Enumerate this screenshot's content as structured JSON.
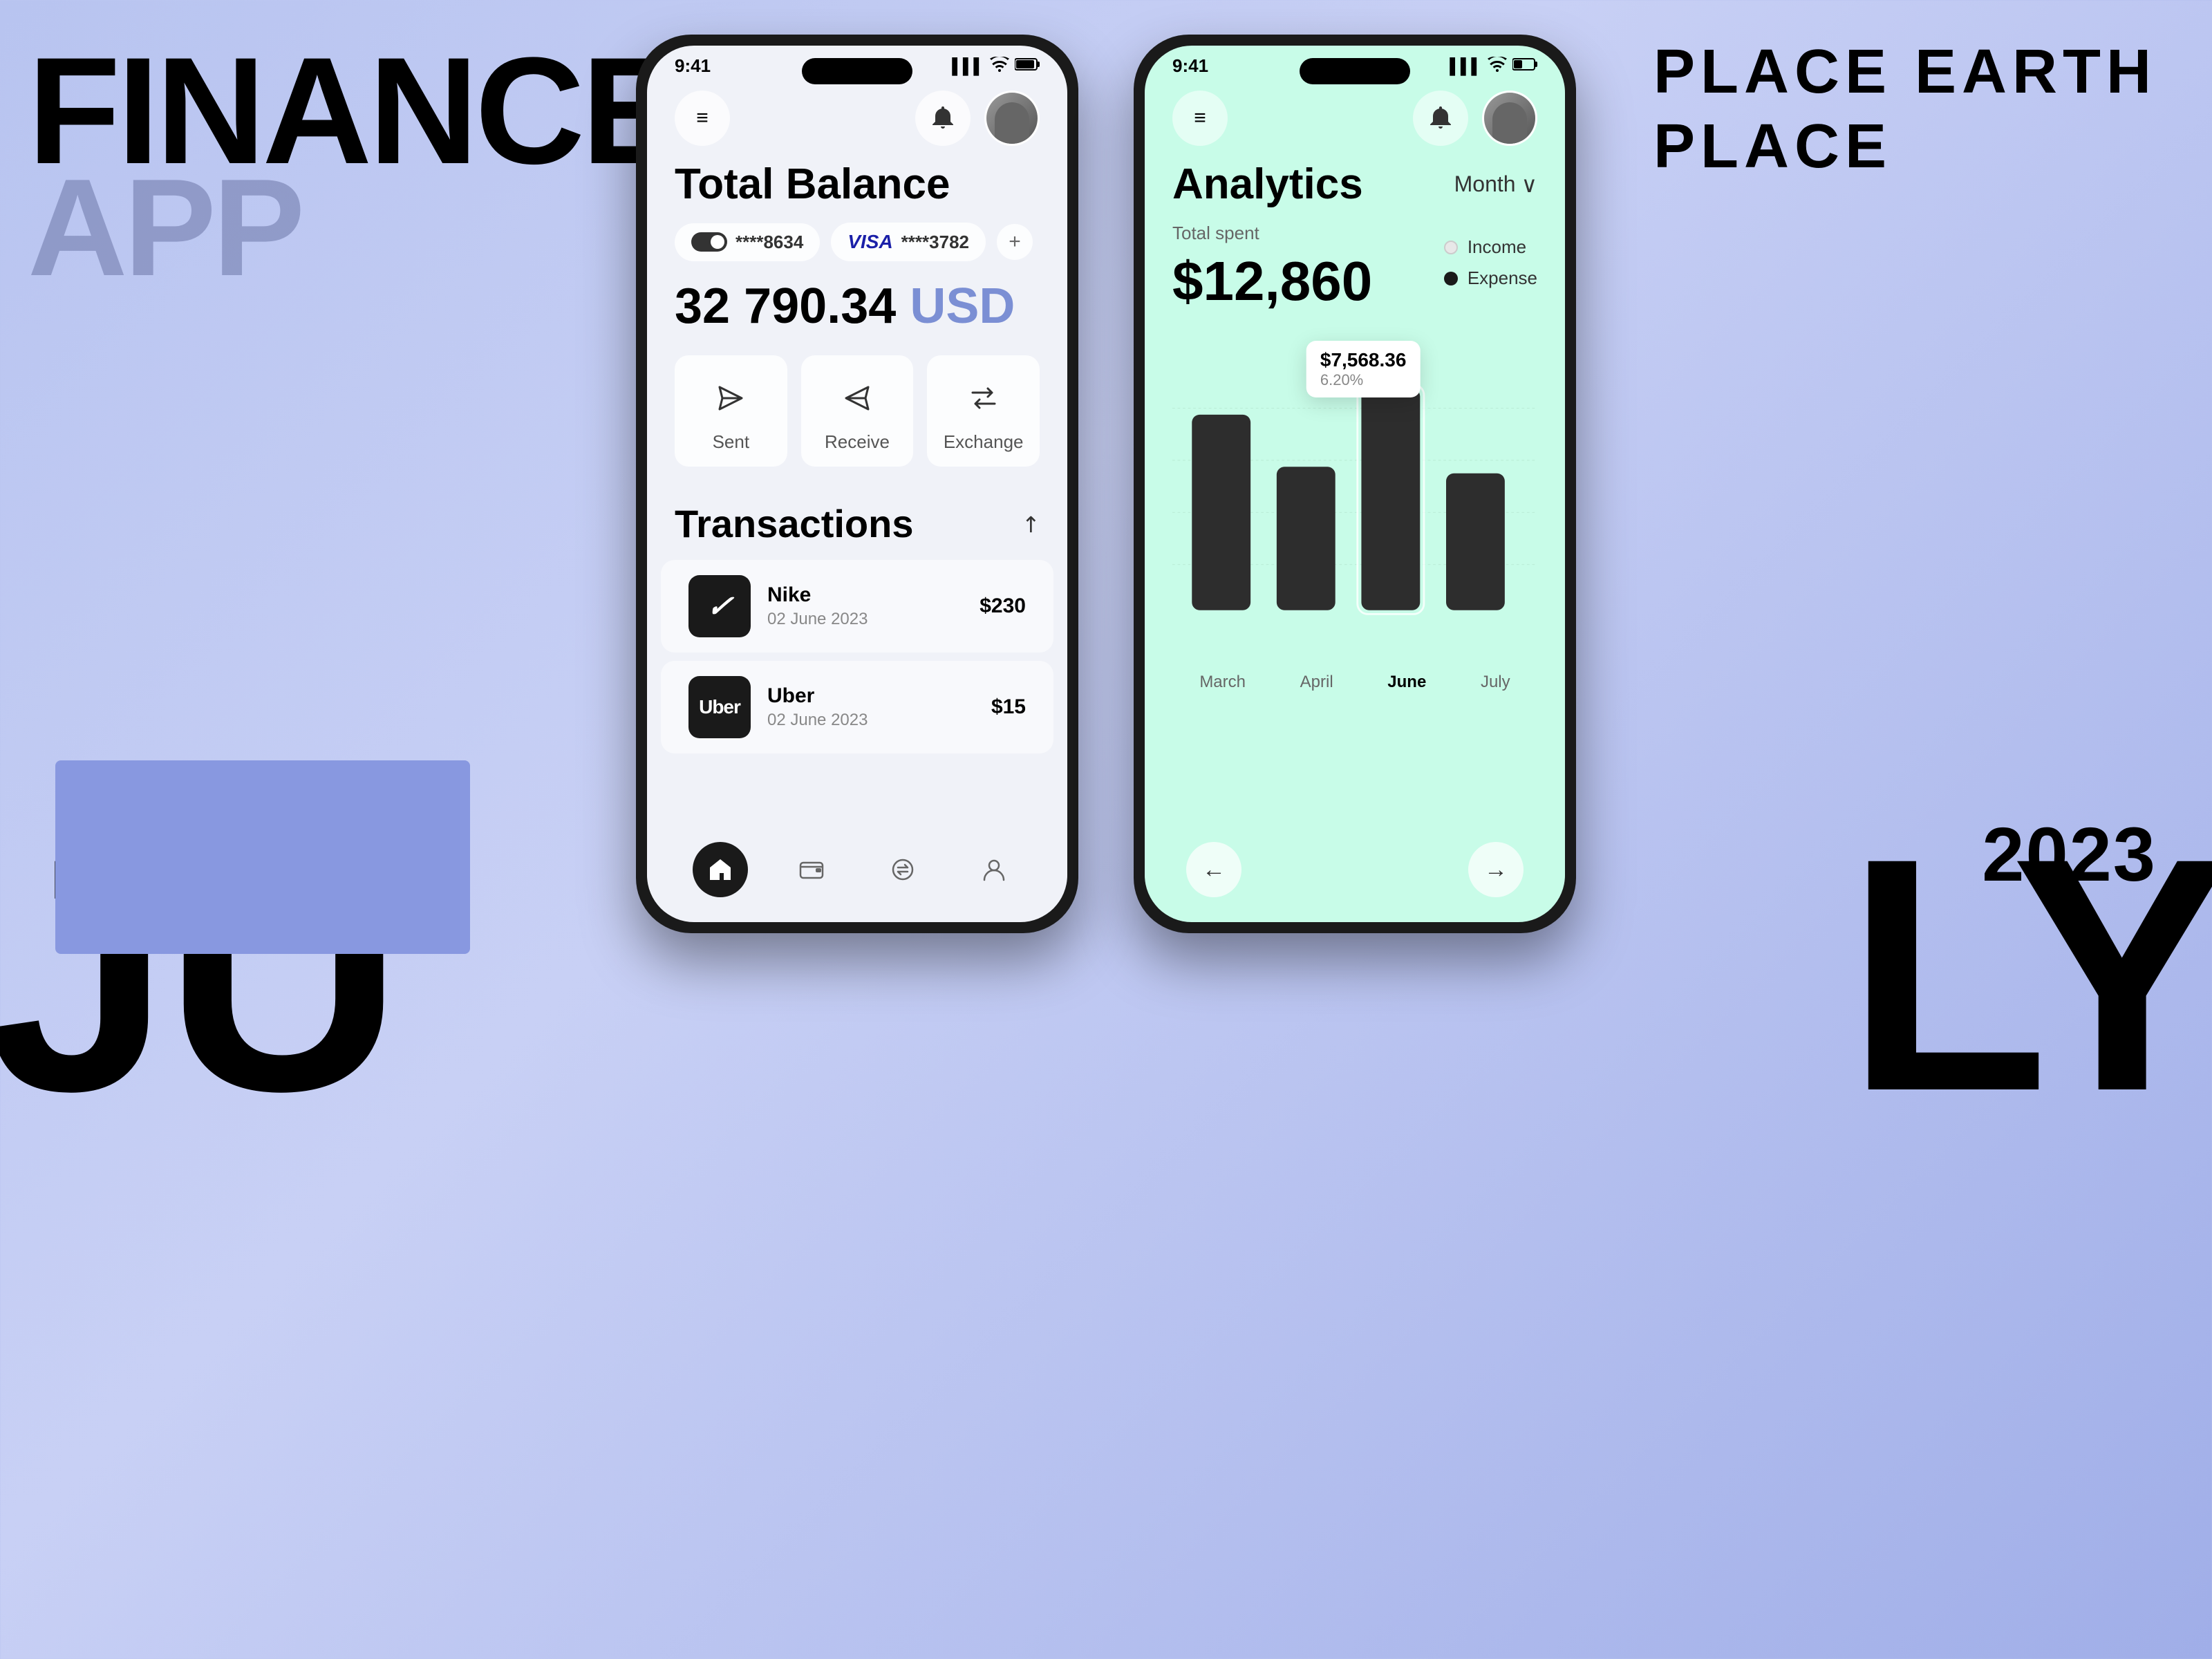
{
  "background": {
    "title_finance": "Finance",
    "title_app": "APP",
    "text_july_left": "Ju",
    "text_july_right": "ly",
    "text_2023": "2023",
    "text_place_line1": "Place  Earth",
    "text_place_line2": "Place"
  },
  "phone_left": {
    "status_time": "9:41",
    "signal_icon": "▌▌▌",
    "wifi_icon": "wifi",
    "battery_icon": "battery",
    "menu_icon": "≡",
    "bell_icon": "🔔",
    "title": "Total Balance",
    "card1_number": "****8634",
    "card2_brand": "VISA",
    "card2_number": "****3782",
    "add_btn": "+",
    "balance": "32 790.34",
    "currency": "USD",
    "sent_label": "Sent",
    "receive_label": "Receive",
    "exchange_label": "Exchange",
    "transactions_title": "Transactions",
    "transactions": [
      {
        "name": "Nike",
        "date": "02 June 2023",
        "amount": "$230",
        "logo_text": "✓",
        "logo_type": "nike"
      },
      {
        "name": "Uber",
        "date": "02 June 2023",
        "amount": "$15",
        "logo_text": "Uber",
        "logo_type": "uber"
      }
    ],
    "nav_items": [
      "home",
      "wallet",
      "exchange",
      "profile"
    ]
  },
  "phone_right": {
    "status_time": "9:41",
    "menu_icon": "≡",
    "bell_icon": "🔔",
    "title": "Analytics",
    "month_selector": "Month ∨",
    "total_spent_label": "Total spent",
    "total_spent_amount": "$12,860",
    "legend_income": "Income",
    "legend_expense": "Expense",
    "chart": {
      "bars": [
        {
          "label": "March",
          "height": 75,
          "active": false
        },
        {
          "label": "April",
          "height": 52,
          "active": false
        },
        {
          "label": "June",
          "height": 85,
          "active": true
        },
        {
          "label": "July",
          "height": 55,
          "active": false
        }
      ],
      "tooltip_amount": "$7,568.36",
      "tooltip_percent": "6.20%"
    },
    "nav_back": "←",
    "nav_forward": "→"
  }
}
